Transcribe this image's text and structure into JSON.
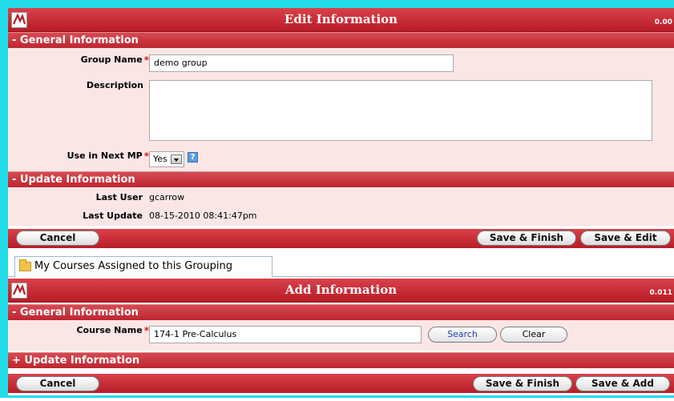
{
  "edit": {
    "title": "Edit Information",
    "timer": "0.00",
    "general_section": "- General Information",
    "group_name_label": "Group Name",
    "group_name_value": "demo group",
    "description_label": "Description",
    "description_value": "",
    "use_next_mp_label": "Use in Next MP",
    "use_next_mp_value": "Yes",
    "help_label": "?",
    "update_section": "- Update Information",
    "last_user_label": "Last User",
    "last_user_value": "gcarrow",
    "last_update_label": "Last Update",
    "last_update_value": "08-15-2010 08:41:47pm",
    "buttons": {
      "cancel": "Cancel",
      "save_finish": "Save & Finish",
      "save_edit": "Save & Edit"
    }
  },
  "tab": {
    "label": "My Courses Assigned to this Grouping"
  },
  "add": {
    "title": "Add Information",
    "timer": "0.011",
    "general_section": "- General Information",
    "course_name_label": "Course Name",
    "course_name_value": "174-1 Pre-Calculus",
    "search_label": "Search",
    "clear_label": "Clear",
    "update_section": "+ Update Information",
    "buttons": {
      "cancel": "Cancel",
      "save_finish": "Save & Finish",
      "save_add": "Save & Add"
    }
  },
  "required_mark": "*",
  "colors": {
    "header_red": "#c0262f",
    "form_pink": "#fbe6e6",
    "frame_cyan": "#22dde8",
    "link_blue": "#1a3fc0"
  }
}
